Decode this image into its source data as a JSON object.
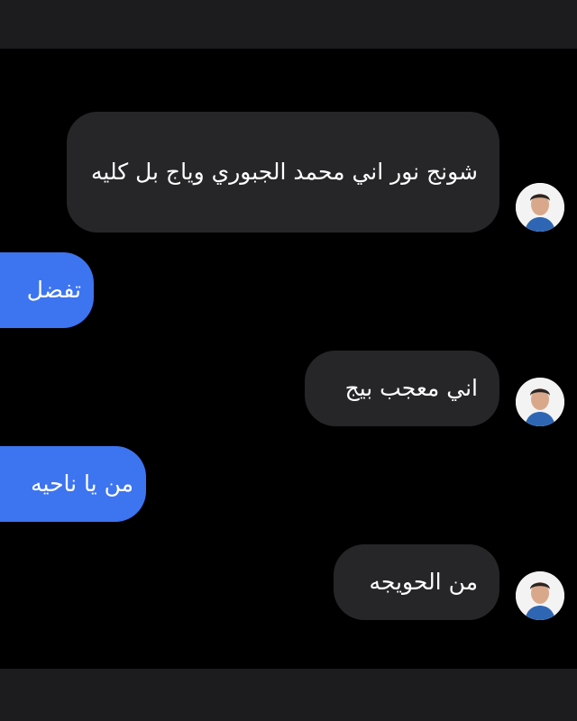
{
  "messages": [
    {
      "direction": "incoming",
      "text": "شونج نور اني محمد الجبوري وياج بل كليه",
      "avatar": "profile-photo"
    },
    {
      "direction": "outgoing",
      "text": "تفضل"
    },
    {
      "direction": "incoming",
      "text": "اني معجب بيج",
      "avatar": "profile-photo"
    },
    {
      "direction": "outgoing",
      "text": "من يا ناحيه"
    },
    {
      "direction": "incoming",
      "text": "من الحويجه",
      "avatar": "profile-photo"
    }
  ],
  "colors": {
    "background": "#000000",
    "incoming_bubble": "#262628",
    "outgoing_bubble": "#3d74f0",
    "text": "#ffffff",
    "bars": "#1c1c1e"
  }
}
